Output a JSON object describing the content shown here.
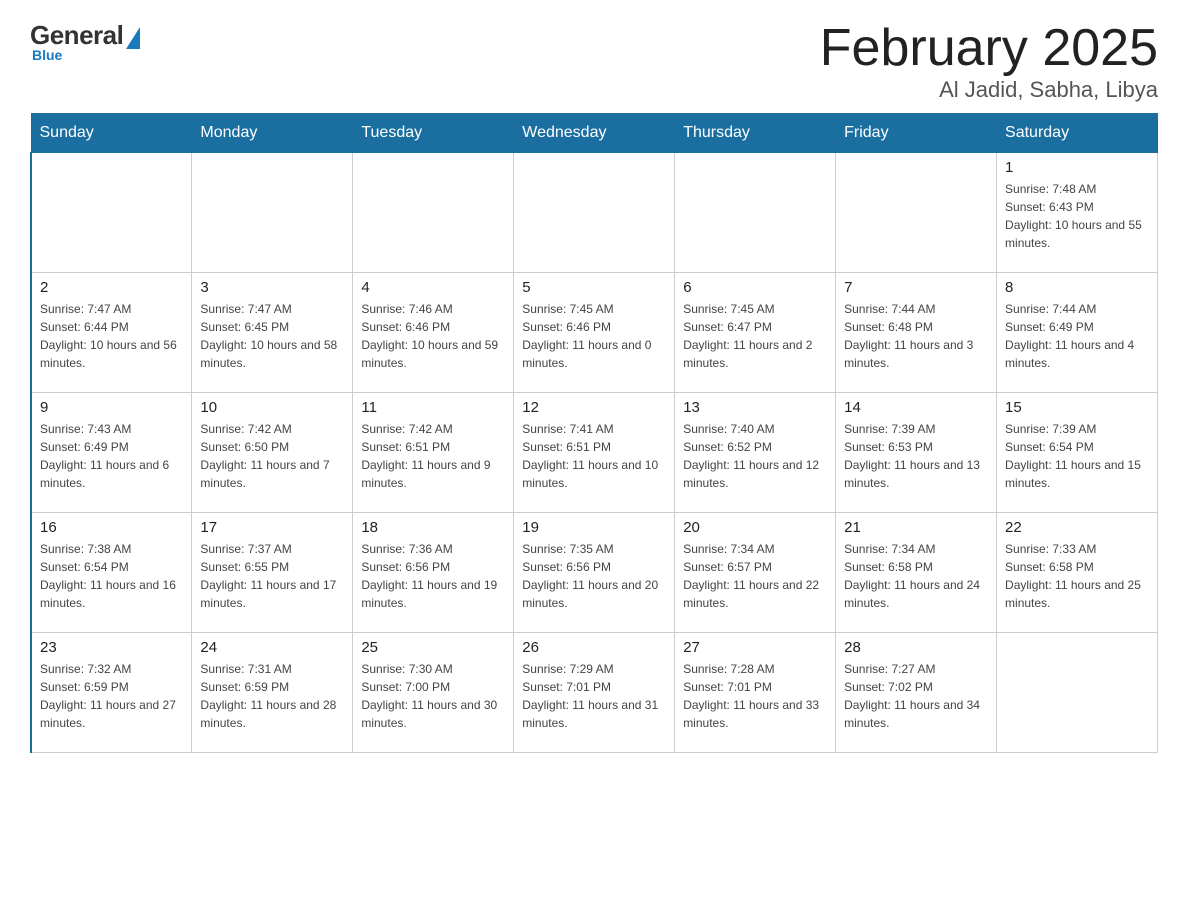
{
  "header": {
    "logo_general": "General",
    "logo_blue": "Blue",
    "month_title": "February 2025",
    "location": "Al Jadid, Sabha, Libya"
  },
  "days_of_week": [
    "Sunday",
    "Monday",
    "Tuesday",
    "Wednesday",
    "Thursday",
    "Friday",
    "Saturday"
  ],
  "weeks": [
    [
      {
        "day": "",
        "sunrise": "",
        "sunset": "",
        "daylight": ""
      },
      {
        "day": "",
        "sunrise": "",
        "sunset": "",
        "daylight": ""
      },
      {
        "day": "",
        "sunrise": "",
        "sunset": "",
        "daylight": ""
      },
      {
        "day": "",
        "sunrise": "",
        "sunset": "",
        "daylight": ""
      },
      {
        "day": "",
        "sunrise": "",
        "sunset": "",
        "daylight": ""
      },
      {
        "day": "",
        "sunrise": "",
        "sunset": "",
        "daylight": ""
      },
      {
        "day": "1",
        "sunrise": "Sunrise: 7:48 AM",
        "sunset": "Sunset: 6:43 PM",
        "daylight": "Daylight: 10 hours and 55 minutes."
      }
    ],
    [
      {
        "day": "2",
        "sunrise": "Sunrise: 7:47 AM",
        "sunset": "Sunset: 6:44 PM",
        "daylight": "Daylight: 10 hours and 56 minutes."
      },
      {
        "day": "3",
        "sunrise": "Sunrise: 7:47 AM",
        "sunset": "Sunset: 6:45 PM",
        "daylight": "Daylight: 10 hours and 58 minutes."
      },
      {
        "day": "4",
        "sunrise": "Sunrise: 7:46 AM",
        "sunset": "Sunset: 6:46 PM",
        "daylight": "Daylight: 10 hours and 59 minutes."
      },
      {
        "day": "5",
        "sunrise": "Sunrise: 7:45 AM",
        "sunset": "Sunset: 6:46 PM",
        "daylight": "Daylight: 11 hours and 0 minutes."
      },
      {
        "day": "6",
        "sunrise": "Sunrise: 7:45 AM",
        "sunset": "Sunset: 6:47 PM",
        "daylight": "Daylight: 11 hours and 2 minutes."
      },
      {
        "day": "7",
        "sunrise": "Sunrise: 7:44 AM",
        "sunset": "Sunset: 6:48 PM",
        "daylight": "Daylight: 11 hours and 3 minutes."
      },
      {
        "day": "8",
        "sunrise": "Sunrise: 7:44 AM",
        "sunset": "Sunset: 6:49 PM",
        "daylight": "Daylight: 11 hours and 4 minutes."
      }
    ],
    [
      {
        "day": "9",
        "sunrise": "Sunrise: 7:43 AM",
        "sunset": "Sunset: 6:49 PM",
        "daylight": "Daylight: 11 hours and 6 minutes."
      },
      {
        "day": "10",
        "sunrise": "Sunrise: 7:42 AM",
        "sunset": "Sunset: 6:50 PM",
        "daylight": "Daylight: 11 hours and 7 minutes."
      },
      {
        "day": "11",
        "sunrise": "Sunrise: 7:42 AM",
        "sunset": "Sunset: 6:51 PM",
        "daylight": "Daylight: 11 hours and 9 minutes."
      },
      {
        "day": "12",
        "sunrise": "Sunrise: 7:41 AM",
        "sunset": "Sunset: 6:51 PM",
        "daylight": "Daylight: 11 hours and 10 minutes."
      },
      {
        "day": "13",
        "sunrise": "Sunrise: 7:40 AM",
        "sunset": "Sunset: 6:52 PM",
        "daylight": "Daylight: 11 hours and 12 minutes."
      },
      {
        "day": "14",
        "sunrise": "Sunrise: 7:39 AM",
        "sunset": "Sunset: 6:53 PM",
        "daylight": "Daylight: 11 hours and 13 minutes."
      },
      {
        "day": "15",
        "sunrise": "Sunrise: 7:39 AM",
        "sunset": "Sunset: 6:54 PM",
        "daylight": "Daylight: 11 hours and 15 minutes."
      }
    ],
    [
      {
        "day": "16",
        "sunrise": "Sunrise: 7:38 AM",
        "sunset": "Sunset: 6:54 PM",
        "daylight": "Daylight: 11 hours and 16 minutes."
      },
      {
        "day": "17",
        "sunrise": "Sunrise: 7:37 AM",
        "sunset": "Sunset: 6:55 PM",
        "daylight": "Daylight: 11 hours and 17 minutes."
      },
      {
        "day": "18",
        "sunrise": "Sunrise: 7:36 AM",
        "sunset": "Sunset: 6:56 PM",
        "daylight": "Daylight: 11 hours and 19 minutes."
      },
      {
        "day": "19",
        "sunrise": "Sunrise: 7:35 AM",
        "sunset": "Sunset: 6:56 PM",
        "daylight": "Daylight: 11 hours and 20 minutes."
      },
      {
        "day": "20",
        "sunrise": "Sunrise: 7:34 AM",
        "sunset": "Sunset: 6:57 PM",
        "daylight": "Daylight: 11 hours and 22 minutes."
      },
      {
        "day": "21",
        "sunrise": "Sunrise: 7:34 AM",
        "sunset": "Sunset: 6:58 PM",
        "daylight": "Daylight: 11 hours and 24 minutes."
      },
      {
        "day": "22",
        "sunrise": "Sunrise: 7:33 AM",
        "sunset": "Sunset: 6:58 PM",
        "daylight": "Daylight: 11 hours and 25 minutes."
      }
    ],
    [
      {
        "day": "23",
        "sunrise": "Sunrise: 7:32 AM",
        "sunset": "Sunset: 6:59 PM",
        "daylight": "Daylight: 11 hours and 27 minutes."
      },
      {
        "day": "24",
        "sunrise": "Sunrise: 7:31 AM",
        "sunset": "Sunset: 6:59 PM",
        "daylight": "Daylight: 11 hours and 28 minutes."
      },
      {
        "day": "25",
        "sunrise": "Sunrise: 7:30 AM",
        "sunset": "Sunset: 7:00 PM",
        "daylight": "Daylight: 11 hours and 30 minutes."
      },
      {
        "day": "26",
        "sunrise": "Sunrise: 7:29 AM",
        "sunset": "Sunset: 7:01 PM",
        "daylight": "Daylight: 11 hours and 31 minutes."
      },
      {
        "day": "27",
        "sunrise": "Sunrise: 7:28 AM",
        "sunset": "Sunset: 7:01 PM",
        "daylight": "Daylight: 11 hours and 33 minutes."
      },
      {
        "day": "28",
        "sunrise": "Sunrise: 7:27 AM",
        "sunset": "Sunset: 7:02 PM",
        "daylight": "Daylight: 11 hours and 34 minutes."
      },
      {
        "day": "",
        "sunrise": "",
        "sunset": "",
        "daylight": ""
      }
    ]
  ]
}
